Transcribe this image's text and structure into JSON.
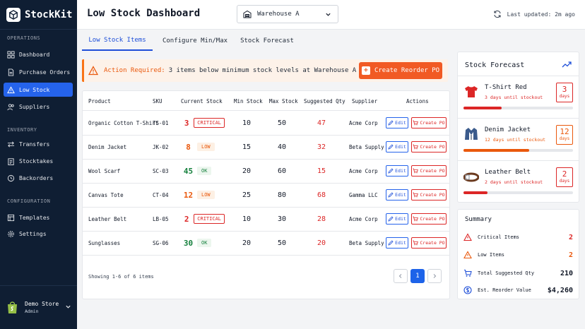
{
  "app": {
    "name": "StockKit"
  },
  "sidebar": {
    "sections": [
      {
        "label": "OPERATIONS"
      },
      {
        "label": "INVENTORY"
      },
      {
        "label": "CONFIGURATION"
      }
    ],
    "items": [
      {
        "label": "Dashboard",
        "icon": "grid-icon"
      },
      {
        "label": "Purchase Orders",
        "icon": "document-icon"
      },
      {
        "label": "Low Stock",
        "icon": "warning-icon",
        "active": true
      },
      {
        "label": "Suppliers",
        "icon": "users-icon"
      },
      {
        "label": "Transfers",
        "icon": "transfer-icon"
      },
      {
        "label": "Stocktakes",
        "icon": "clipboard-icon"
      },
      {
        "label": "Backorders",
        "icon": "history-icon"
      },
      {
        "label": "Templates",
        "icon": "template-icon"
      },
      {
        "label": "Settings",
        "icon": "gear-icon"
      }
    ],
    "store": {
      "name": "Demo Store",
      "role": "Admin"
    }
  },
  "header": {
    "title": "Low Stock Dashboard",
    "warehouse": "Warehouse A",
    "updated": "Last updated: 2m ago"
  },
  "tabs": [
    {
      "label": "Low Stock Items",
      "active": true
    },
    {
      "label": "Configure Min/Max"
    },
    {
      "label": "Stock Forecast"
    }
  ],
  "alert": {
    "label": "Action Required:",
    "message": "3 items below minimum stock levels at Warehouse A",
    "button": "Create Reorder PO"
  },
  "table": {
    "columns": [
      "Product",
      "SKU",
      "Current Stock",
      "Min Stock",
      "Max Stock",
      "Suggested Qty",
      "Supplier",
      "Actions"
    ],
    "rows": [
      {
        "product": "Organic Cotton T-Shirt",
        "sku": "TS-01",
        "current": "3",
        "status": "CRITICAL",
        "min": "10",
        "max": "50",
        "suggested": "47",
        "supplier": "Acme Corp"
      },
      {
        "product": "Denim Jacket",
        "sku": "JK-02",
        "current": "8",
        "status": "LOW",
        "min": "15",
        "max": "40",
        "suggested": "32",
        "supplier": "Beta Supply"
      },
      {
        "product": "Wool Scarf",
        "sku": "SC-03",
        "current": "45",
        "status": "OK",
        "min": "20",
        "max": "60",
        "suggested": "15",
        "supplier": "Acme Corp"
      },
      {
        "product": "Canvas Tote",
        "sku": "CT-04",
        "current": "12",
        "status": "LOW",
        "min": "25",
        "max": "80",
        "suggested": "68",
        "supplier": "Gamma LLC"
      },
      {
        "product": "Leather Belt",
        "sku": "LB-05",
        "current": "2",
        "status": "CRITICAL",
        "min": "10",
        "max": "30",
        "suggested": "28",
        "supplier": "Acme Corp"
      },
      {
        "product": "Sunglasses",
        "sku": "SG-06",
        "current": "30",
        "status": "OK",
        "min": "20",
        "max": "50",
        "suggested": "20",
        "supplier": "Beta Supply"
      }
    ],
    "edit_label": "Edit",
    "po_label": "Create PO",
    "showing": "Showing 1-6 of 6 items",
    "page": "1"
  },
  "forecast": {
    "title": "Stock Forecast",
    "items": [
      {
        "name": "T-Shirt Red",
        "sub": "3 days until stockout",
        "days": "3",
        "unit": "days",
        "fraction": 0.35,
        "color": "#dc2626"
      },
      {
        "name": "Denim Jacket",
        "sub": "12 days until stockout",
        "days": "12",
        "unit": "days",
        "fraction": 0.6,
        "color": "#ea580c"
      },
      {
        "name": "Leather Belt",
        "sub": "2 days until stockout",
        "days": "2",
        "unit": "days",
        "fraction": 0.22,
        "color": "#dc2626"
      }
    ]
  },
  "summary": {
    "title": "Summary",
    "rows": [
      {
        "label": "Critical Items",
        "value": "2"
      },
      {
        "label": "Low Items",
        "value": "2"
      },
      {
        "label": "Total Suggested Qty",
        "value": "210"
      },
      {
        "label": "Est. Reorder Value",
        "value": "$4,260"
      }
    ]
  },
  "colors": {
    "sidebar": "#0f1e33",
    "accent": "#2563eb",
    "orange": "#f15a24",
    "critical": "#dc2626",
    "ok": "#15803d"
  }
}
